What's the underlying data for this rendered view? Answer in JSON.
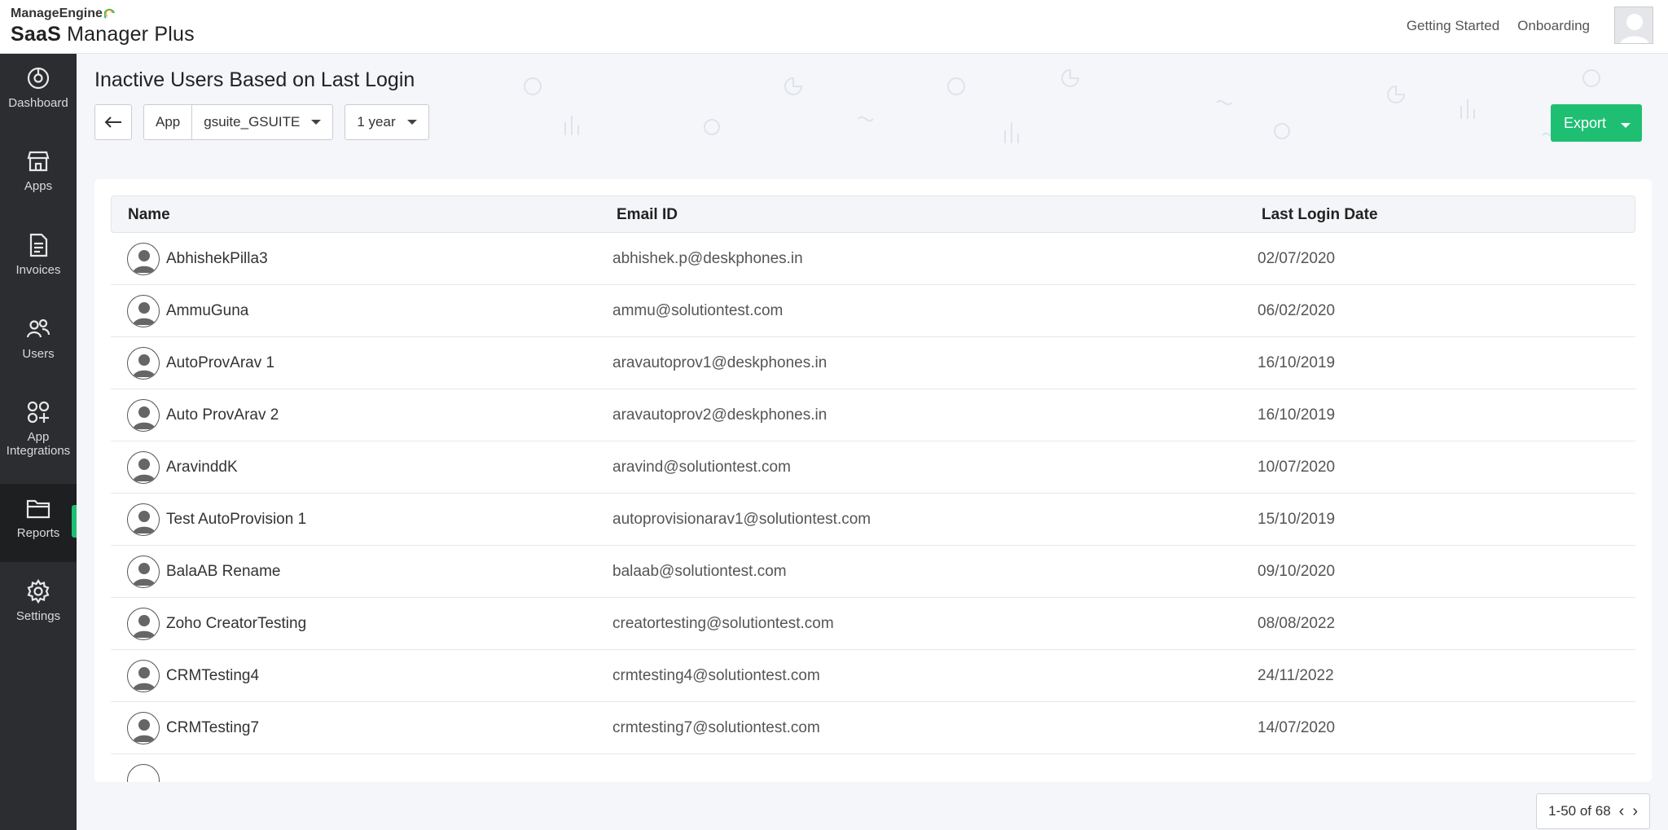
{
  "brand": {
    "top": "ManageEngine",
    "product_bold": "SaaS",
    "product_rest": "Manager Plus"
  },
  "header": {
    "links": [
      "Getting Started",
      "Onboarding"
    ]
  },
  "sidebar": {
    "items": [
      {
        "label": "Dashboard",
        "icon": "dashboard-icon"
      },
      {
        "label": "Apps",
        "icon": "apps-store-icon"
      },
      {
        "label": "Invoices",
        "icon": "invoice-icon"
      },
      {
        "label": "Users",
        "icon": "users-icon"
      },
      {
        "label": "App Integrations",
        "icon": "app-integrations-icon"
      },
      {
        "label": "Reports",
        "icon": "reports-folder-icon",
        "active": true
      },
      {
        "label": "Settings",
        "icon": "gear-icon"
      }
    ]
  },
  "page": {
    "title": "Inactive Users Based on Last Login",
    "filter_label": "App",
    "app_value": "gsuite_GSUITE",
    "period_value": "1 year",
    "export_label": "Export"
  },
  "table": {
    "columns": [
      "Name",
      "Email ID",
      "Last Login Date"
    ],
    "rows": [
      {
        "name": "AbhishekPilla3",
        "email": "abhishek.p@deskphones.in",
        "date": "02/07/2020"
      },
      {
        "name": "AmmuGuna",
        "email": "ammu@solutiontest.com",
        "date": "06/02/2020"
      },
      {
        "name": "AutoProvArav 1",
        "email": "aravautoprov1@deskphones.in",
        "date": "16/10/2019"
      },
      {
        "name": "Auto ProvArav 2",
        "email": "aravautoprov2@deskphones.in",
        "date": "16/10/2019"
      },
      {
        "name": "AravinddK",
        "email": "aravind@solutiontest.com",
        "date": "10/07/2020"
      },
      {
        "name": "Test AutoProvision 1",
        "email": "autoprovisionarav1@solutiontest.com",
        "date": "15/10/2019"
      },
      {
        "name": "BalaAB Rename",
        "email": "balaab@solutiontest.com",
        "date": "09/10/2020"
      },
      {
        "name": "Zoho CreatorTesting",
        "email": "creatortesting@solutiontest.com",
        "date": "08/08/2022"
      },
      {
        "name": "CRMTesting4",
        "email": "crmtesting4@solutiontest.com",
        "date": "24/11/2022"
      },
      {
        "name": "CRMTesting7",
        "email": "crmtesting7@solutiontest.com",
        "date": "14/07/2020"
      }
    ]
  },
  "pager": {
    "text": "1-50 of 68"
  },
  "colors": {
    "accent": "#1fbf73",
    "sidebar": "#2b2d30"
  }
}
